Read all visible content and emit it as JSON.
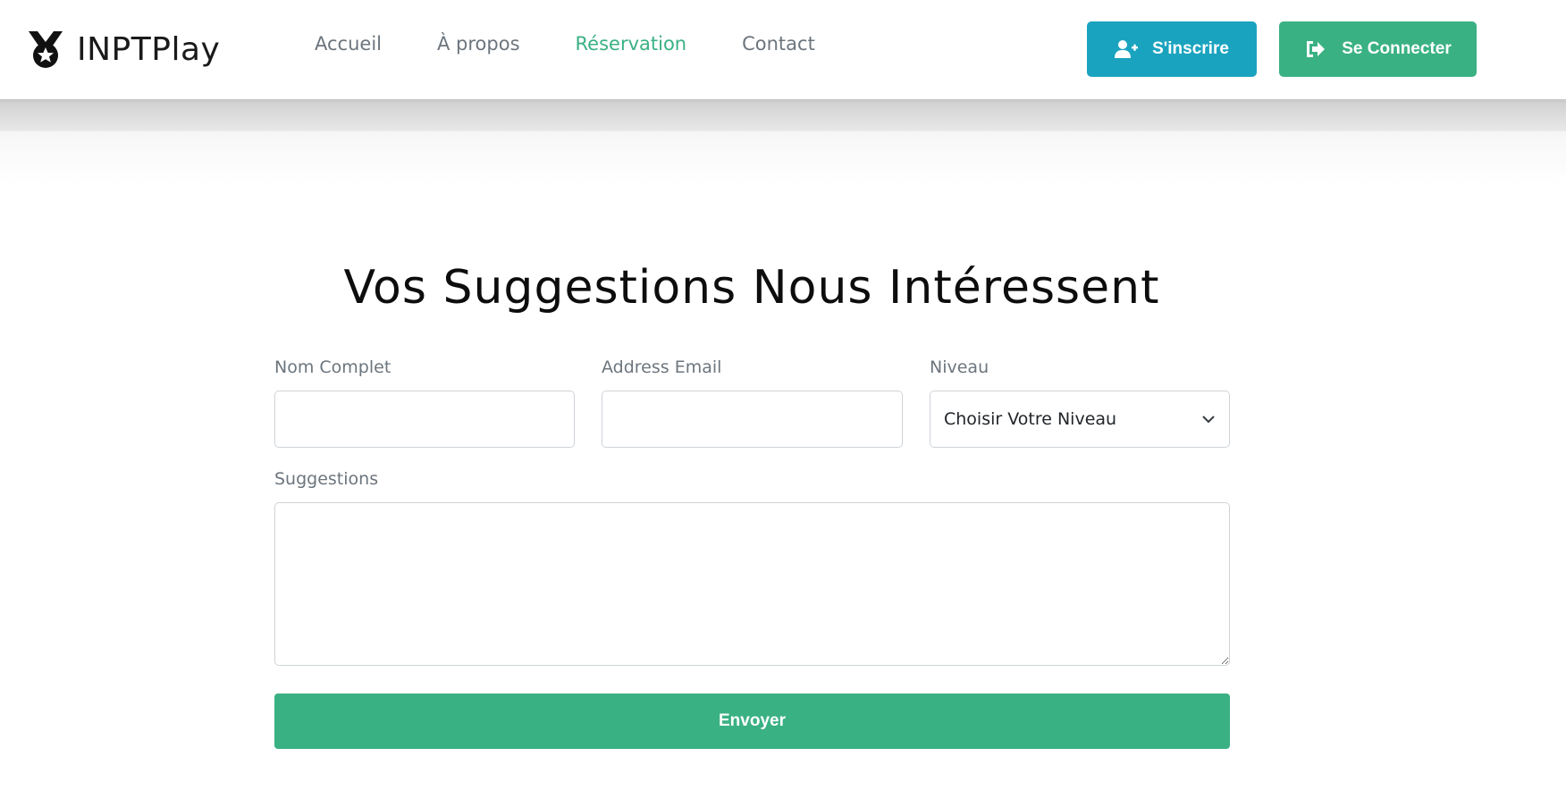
{
  "brand": {
    "name": "INPTPlay",
    "icon": "medal-star-icon"
  },
  "nav": {
    "links": [
      {
        "label": "Accueil",
        "active": false
      },
      {
        "label": "À propos",
        "active": false
      },
      {
        "label": "Réservation",
        "active": true
      },
      {
        "label": "Contact",
        "active": false
      }
    ]
  },
  "header_buttons": {
    "register": {
      "label": "S'inscrire",
      "icon": "user-plus-icon",
      "color": "#1aa3bf"
    },
    "login": {
      "label": "Se Connecter",
      "icon": "sign-in-icon",
      "color": "#3ab183"
    }
  },
  "colors": {
    "accent": "#3ab183",
    "info": "#1aa3bf",
    "muted_text": "#6c757d"
  },
  "form": {
    "title": "Vos Suggestions Nous Intéressent",
    "name_field": {
      "label": "Nom Complet",
      "value": ""
    },
    "email_field": {
      "label": "Address Email",
      "value": ""
    },
    "level_field": {
      "label": "Niveau",
      "selected": "Choisir Votre Niveau"
    },
    "suggestions_field": {
      "label": "Suggestions",
      "value": ""
    },
    "submit_label": "Envoyer"
  }
}
